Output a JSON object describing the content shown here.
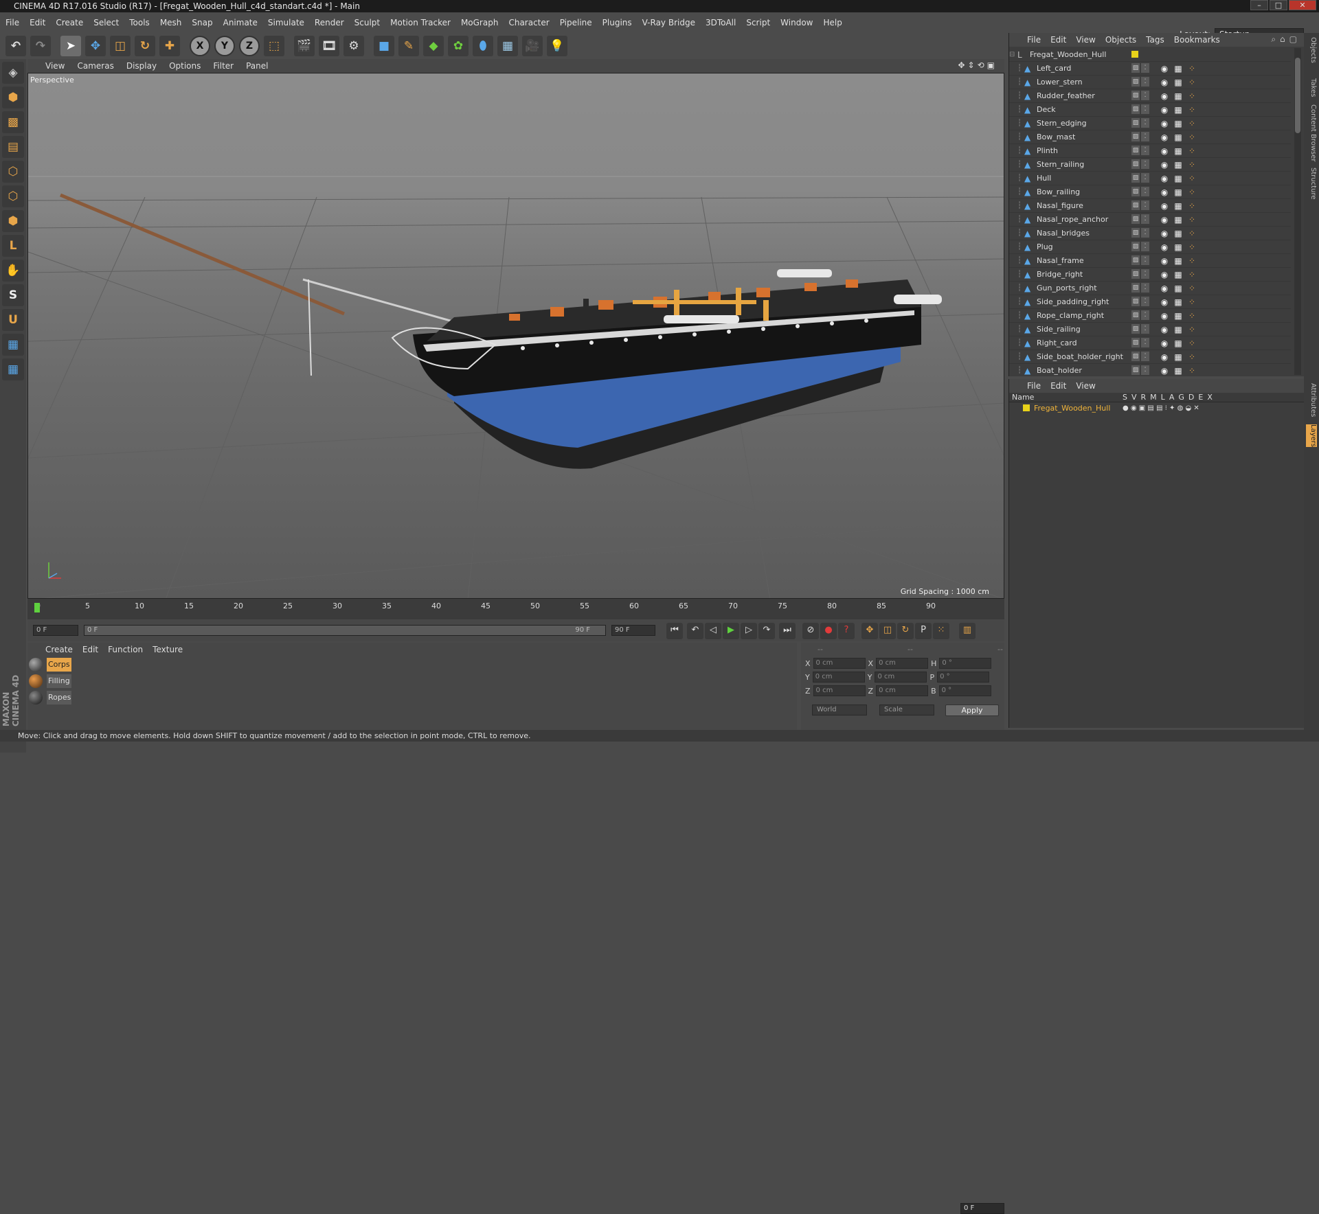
{
  "window": {
    "title": "CINEMA 4D R17.016 Studio (R17) - [Fregat_Wooden_Hull_c4d_standart.c4d *] - Main"
  },
  "menubar": {
    "items": [
      "File",
      "Edit",
      "Create",
      "Select",
      "Tools",
      "Mesh",
      "Snap",
      "Animate",
      "Simulate",
      "Render",
      "Sculpt",
      "Motion Tracker",
      "MoGraph",
      "Character",
      "Pipeline",
      "Plugins",
      "V-Ray Bridge",
      "3DToAll",
      "Script",
      "Window",
      "Help"
    ],
    "layout_label": "Layout:",
    "layout_value": "Startup"
  },
  "toolbar": {
    "icons": [
      "undo-icon",
      "redo-icon",
      "select-arrow-icon",
      "move-icon",
      "scale-icon",
      "rotate-icon",
      "transform-icon",
      "x-axis-icon",
      "y-axis-icon",
      "z-axis-icon",
      "coordinate-system-icon",
      "render-view-icon",
      "render-picture-icon",
      "render-settings-icon",
      "cube-primitive-icon",
      "spline-pen-icon",
      "subdivision-icon",
      "cloner-icon",
      "deformer-icon",
      "floor-icon",
      "camera-icon",
      "light-icon"
    ],
    "axis_labels": [
      "X",
      "Y",
      "Z"
    ]
  },
  "viewport": {
    "menu": [
      "View",
      "Cameras",
      "Display",
      "Options",
      "Filter",
      "Panel"
    ],
    "label": "Perspective",
    "grid_spacing": "Grid Spacing : 1000 cm"
  },
  "timeline": {
    "ticks": [
      "0",
      "5",
      "10",
      "15",
      "20",
      "25",
      "30",
      "35",
      "40",
      "45",
      "50",
      "55",
      "60",
      "65",
      "70",
      "75",
      "80",
      "85",
      "90"
    ],
    "current_frame": "0 F",
    "start_field": "0 F",
    "range_start": "0 F",
    "range_end": "90 F",
    "end_field": "90 F"
  },
  "materials": {
    "menu": [
      "Create",
      "Edit",
      "Function",
      "Texture"
    ],
    "items": [
      {
        "name": "Corps",
        "selected": true
      },
      {
        "name": "Filling",
        "selected": false
      },
      {
        "name": "Ropes",
        "selected": false
      }
    ]
  },
  "coordinates": {
    "header": [
      "--",
      "--",
      "--"
    ],
    "rows": [
      {
        "a": "X",
        "a_val": "0 cm",
        "b": "X",
        "b_val": "0 cm",
        "c": "H",
        "c_val": "0 °"
      },
      {
        "a": "Y",
        "a_val": "0 cm",
        "b": "Y",
        "b_val": "0 cm",
        "c": "P",
        "c_val": "0 °"
      },
      {
        "a": "Z",
        "a_val": "0 cm",
        "b": "Z",
        "b_val": "0 cm",
        "c": "B",
        "c_val": "0 °"
      }
    ],
    "world": "World",
    "scale": "Scale",
    "apply": "Apply"
  },
  "object_manager": {
    "menu": [
      "File",
      "Edit",
      "View",
      "Objects",
      "Tags",
      "Bookmarks"
    ],
    "root": "Fregat_Wooden_Hull",
    "objects": [
      "Left_card",
      "Lower_stern",
      "Rudder_feather",
      "Deck",
      "Stern_edging",
      "Bow_mast",
      "Plinth",
      "Stern_railing",
      "Hull",
      "Bow_railing",
      "Nasal_figure",
      "Nasal_rope_anchor",
      "Nasal_bridges",
      "Plug",
      "Nasal_frame",
      "Bridge_right",
      "Gun_ports_right",
      "Side_padding_right",
      "Rope_clamp_right",
      "Side_railing",
      "Right_card",
      "Side_boat_holder_right",
      "Boat_holder"
    ]
  },
  "layer_manager": {
    "menu": [
      "File",
      "Edit",
      "View"
    ],
    "name_header": "Name",
    "columns": [
      "S",
      "V",
      "R",
      "M",
      "L",
      "A",
      "G",
      "D",
      "E",
      "X"
    ],
    "layer": "Fregat_Wooden_Hull"
  },
  "side_tabs": [
    "Objects",
    "Takes",
    "Content Browser",
    "Structure",
    "Attributes",
    "Layers"
  ],
  "brand": "MAXON CINEMA 4D",
  "status": "Move: Click and drag to move elements. Hold down SHIFT to quantize movement / add to the selection in point mode, CTRL to remove."
}
